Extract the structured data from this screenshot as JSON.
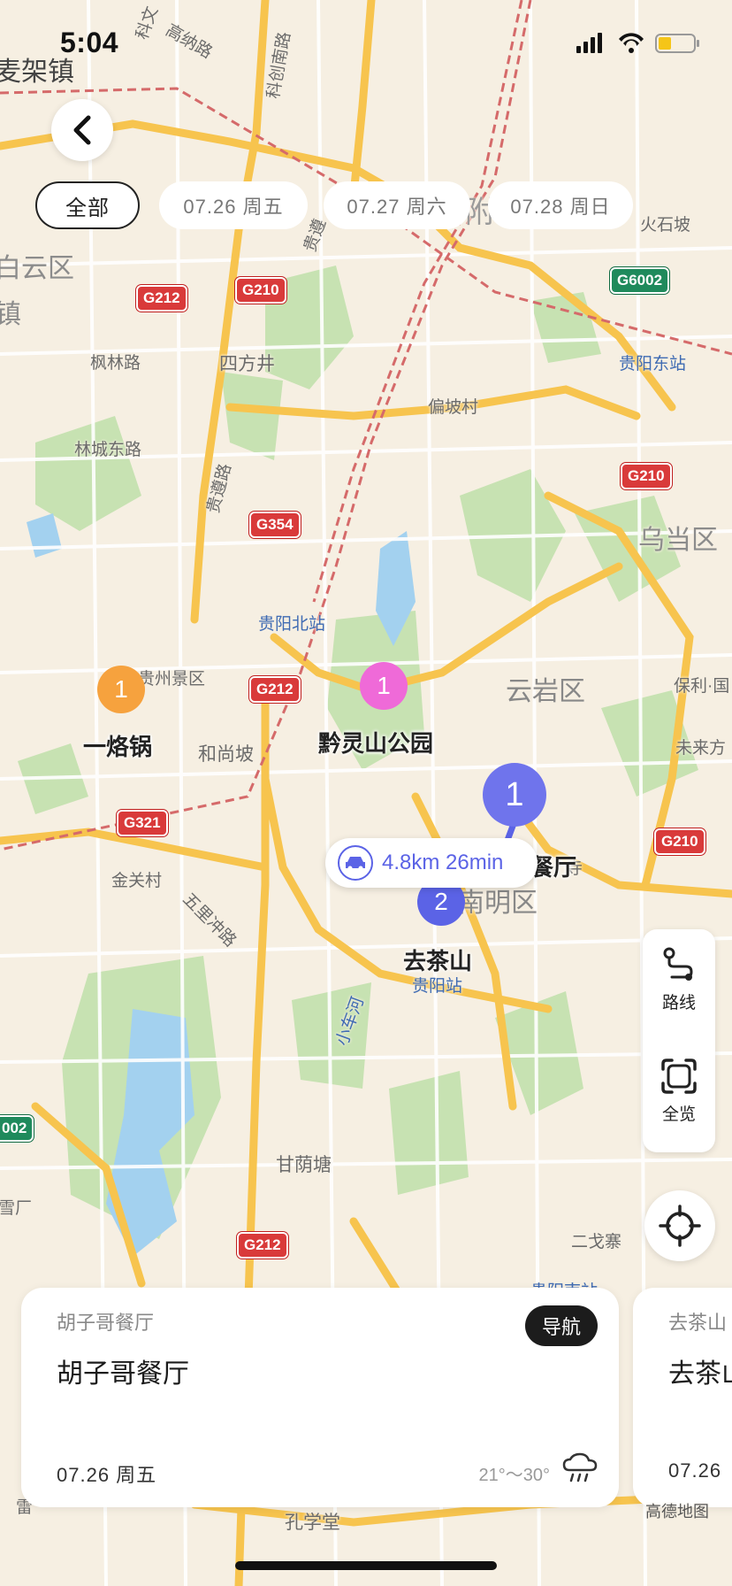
{
  "status": {
    "time": "5:04"
  },
  "tabs": [
    {
      "label": "全部",
      "active": true
    },
    {
      "label": "07.26 周五",
      "active": false
    },
    {
      "label": "07.27 周六",
      "active": false
    },
    {
      "label": "07.28 周日",
      "active": false
    }
  ],
  "map": {
    "labels": {
      "town_top": "麦架镇",
      "district_baiyun": "白云区",
      "town_left": "镇",
      "road_kechuang": "科创南路",
      "road_gaona": "高纳路",
      "road_kewen": "科文",
      "road_guizun": "贵遵",
      "district_wudang": "乌当区",
      "huoshipo": "火石坡",
      "fenglin": "枫林路",
      "sifangjing": "四方井",
      "pianpo": "偏坡村",
      "lincheng": "林城东路",
      "guizun2": "贵遵路",
      "yunyan": "云岩区",
      "guizhou_scenic": "贵州景区",
      "heshangpo": "和尚坡",
      "baoli": "保利·国",
      "weilai": "未来方",
      "jinguan": "金关村",
      "wulichong": "五里冲路",
      "nanming": "南明区",
      "xiaochehe": "小车河",
      "ganyintang": "甘荫塘",
      "xuechang": "雪厂",
      "ergesai": "二戈寨",
      "kongxue": "孔学堂",
      "fu": "附",
      "si": "寺",
      "lei": "雷"
    },
    "stations": {
      "guiyang_east": "贵阳东站",
      "guiyang_north": "贵阳北站",
      "guiyang": "贵阳站",
      "guiyang_south": "贵阳南站"
    },
    "highways": {
      "g212_a": "G212",
      "g210_a": "G210",
      "g6002_a": "G6002",
      "g210_b": "G210",
      "g354": "G354",
      "g212_b": "G212",
      "g321": "G321",
      "g210_c": "G210",
      "g6002_b": "002",
      "g212_c": "G212"
    },
    "places": {
      "yiluoguo": "一烙锅",
      "qianling": "黔灵山公园",
      "canting": "餐厅",
      "quchashan": "去茶山"
    },
    "markers": [
      {
        "num": "1",
        "color": "#f6a23e"
      },
      {
        "num": "1",
        "color": "#ef6ad8"
      },
      {
        "num": "1",
        "color": "#6f74ec"
      },
      {
        "num": "2",
        "color": "#5b63e6"
      }
    ],
    "route": {
      "text": "4.8km 26min"
    }
  },
  "controls": {
    "route_label": "路线",
    "overview_label": "全览"
  },
  "cards": [
    {
      "subtitle": "胡子哥餐厅",
      "title": "胡子哥餐厅",
      "nav_label": "导航",
      "date": "07.26 周五",
      "weather": "21°～30°"
    },
    {
      "subtitle": "去茶山",
      "title": "去茶山",
      "date": "07.26"
    }
  ],
  "footer": {
    "map_brand": "高德地图"
  },
  "colors": {
    "accent": "#5b63e6",
    "road": "#f7c44e",
    "park": "#c9e3b4",
    "water": "#9fd0ef"
  },
  "icons": [
    "back-arrow-icon",
    "signal-icon",
    "wifi-icon",
    "battery-icon",
    "car-icon",
    "route-icon",
    "overview-icon",
    "locate-icon",
    "rain-cloud-icon"
  ]
}
